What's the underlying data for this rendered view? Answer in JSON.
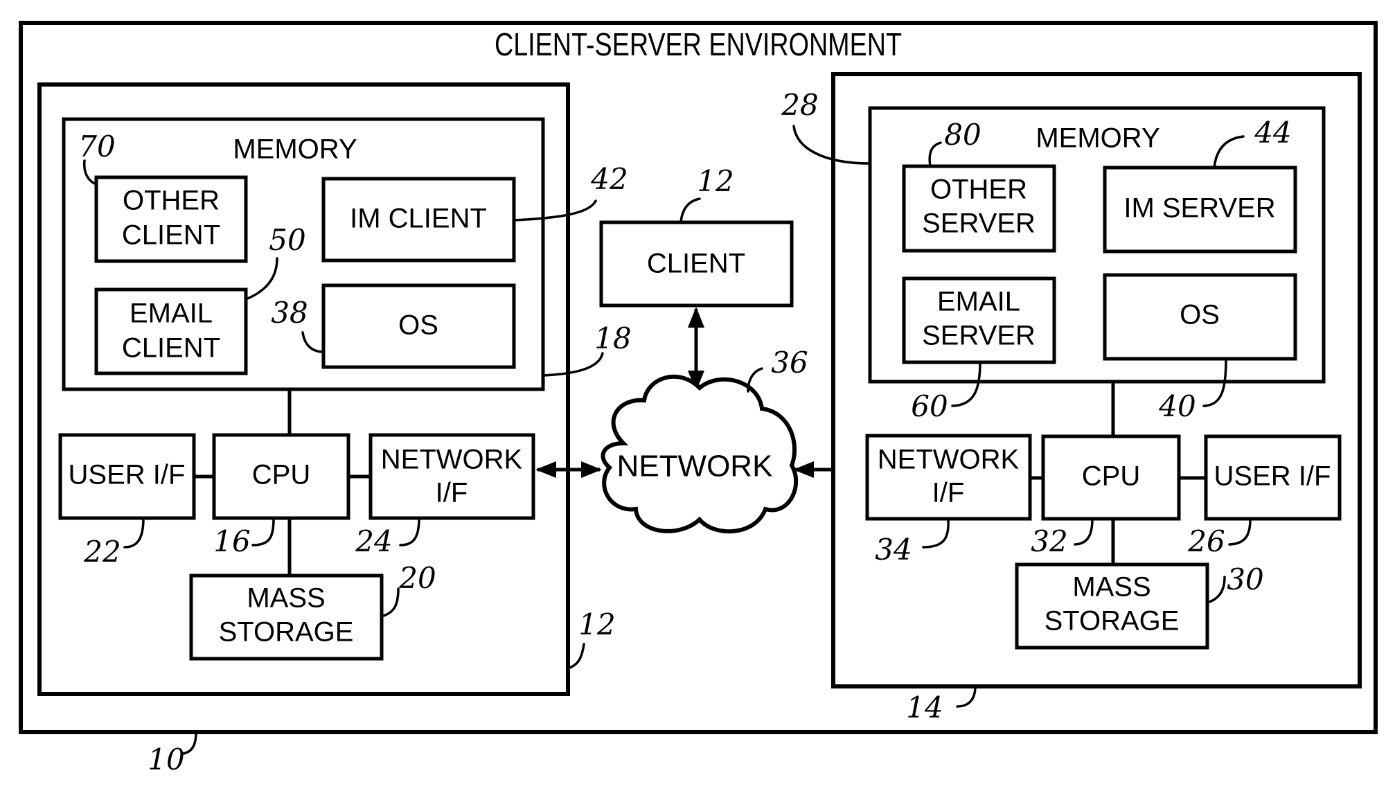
{
  "title": "CLIENT-SERVER ENVIRONMENT",
  "colors": {
    "stroke": "#000000",
    "background": "#ffffff"
  },
  "client_computer": {
    "ref": "12",
    "memory": {
      "label": "MEMORY",
      "ref": "18",
      "other_client": {
        "line1": "OTHER",
        "line2": "CLIENT",
        "ref": "70"
      },
      "im_client": {
        "label": "IM CLIENT",
        "ref": "42"
      },
      "email_client": {
        "line1": "EMAIL",
        "line2": "CLIENT",
        "ref": "50"
      },
      "os": {
        "label": "OS",
        "ref": "38"
      }
    },
    "user_if": {
      "label": "USER I/F",
      "ref": "22"
    },
    "cpu": {
      "label": "CPU",
      "ref": "16"
    },
    "network_if": {
      "line1": "NETWORK",
      "line2": "I/F",
      "ref": "24"
    },
    "mass_storage": {
      "line1": "MASS",
      "line2": "STORAGE",
      "ref": "20"
    }
  },
  "other_client": {
    "label": "CLIENT",
    "ref": "12"
  },
  "network": {
    "label": "NETWORK",
    "ref": "36"
  },
  "server_computer": {
    "ref": "14",
    "memory": {
      "label": "MEMORY",
      "ref": "28",
      "other_server": {
        "line1": "OTHER",
        "line2": "SERVER",
        "ref": "80"
      },
      "im_server": {
        "label": "IM SERVER",
        "ref": "44"
      },
      "email_server": {
        "line1": "EMAIL",
        "line2": "SERVER",
        "ref": "60"
      },
      "os": {
        "label": "OS",
        "ref": "40"
      }
    },
    "network_if": {
      "line1": "NETWORK",
      "line2": "I/F",
      "ref": "34"
    },
    "cpu": {
      "label": "CPU",
      "ref": "32"
    },
    "user_if": {
      "label": "USER I/F",
      "ref": "26"
    },
    "mass_storage": {
      "line1": "MASS",
      "line2": "STORAGE",
      "ref": "30"
    }
  },
  "environment_ref": "10"
}
